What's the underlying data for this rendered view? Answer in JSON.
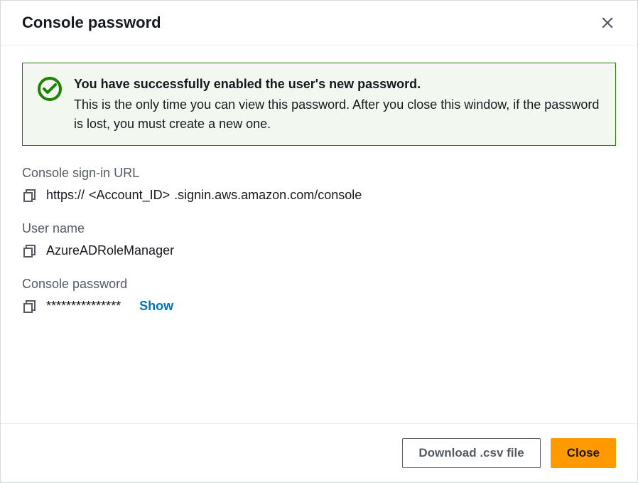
{
  "dialog": {
    "title": "Console password",
    "alert": {
      "title": "You have successfully enabled the user's new password.",
      "body": "This is the only time you can view this password. After you close this window, if the password is lost, you must create a new one."
    },
    "fields": {
      "signin_url": {
        "label": "Console sign-in URL",
        "prefix": "https://",
        "account": "<Account_ID>",
        "suffix": ".signin.aws.amazon.com/console"
      },
      "username": {
        "label": "User name",
        "value": "AzureADRoleManager"
      },
      "password": {
        "label": "Console password",
        "masked": "***************",
        "show_label": "Show"
      }
    },
    "footer": {
      "download_label": "Download .csv file",
      "close_label": "Close"
    }
  }
}
